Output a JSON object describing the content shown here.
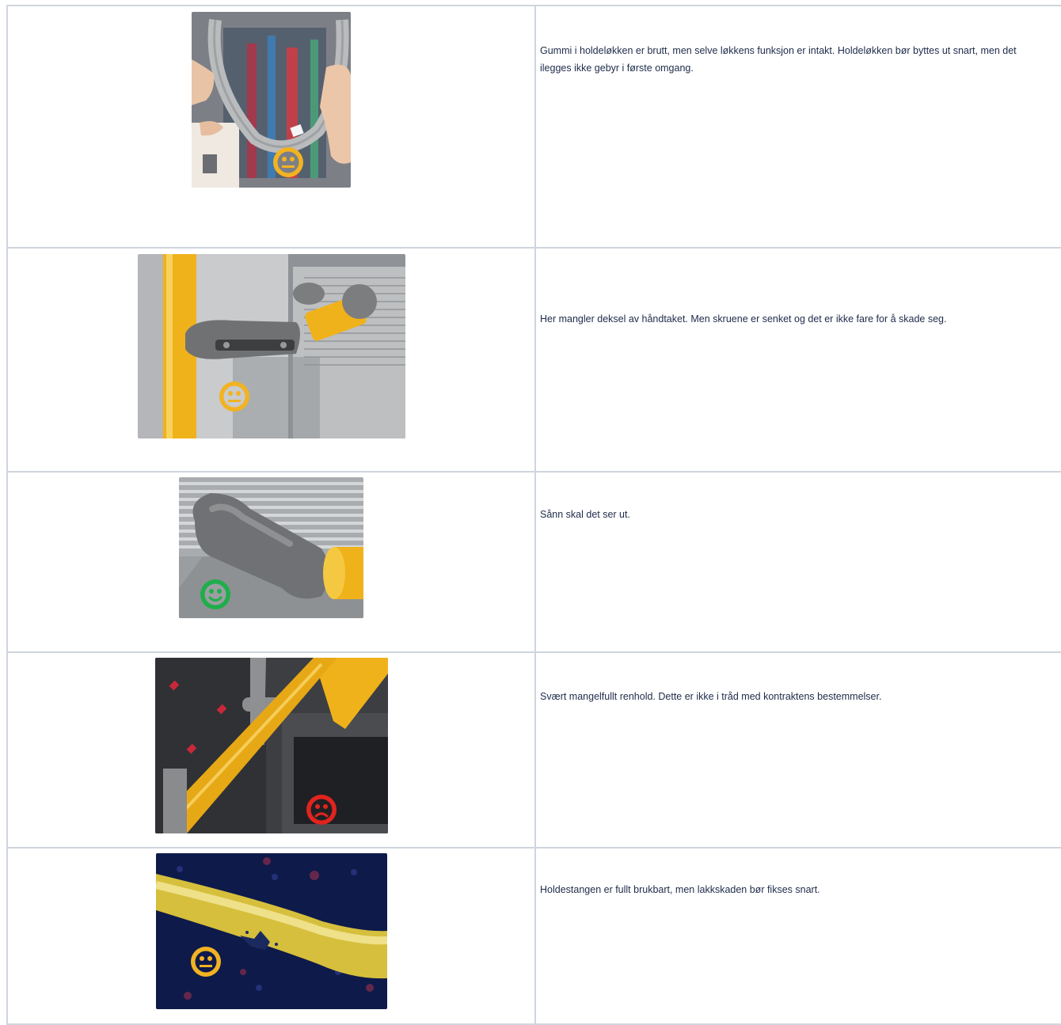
{
  "rows": [
    {
      "description": "Gummi i holdeløkken er brutt, men selve løkkens funksjon er intakt. Holdeløkken bør byttes ut snart, men det ilegges ikke gebyr i første omgang.",
      "rating": "neutral",
      "icon": "neutral-face-icon",
      "color": "#f2b322"
    },
    {
      "description": "Her mangler deksel av håndtaket. Men skruene er senket og det er ikke fare for å skade seg.",
      "rating": "neutral",
      "icon": "neutral-face-icon",
      "color": "#f2b322"
    },
    {
      "description": "Sånn skal det ser ut.",
      "rating": "happy",
      "icon": "happy-face-icon",
      "color": "#1fae4b"
    },
    {
      "description": "Svært mangelfullt renhold. Dette er ikke i tråd med kontraktens bestemmelser.",
      "rating": "sad",
      "icon": "sad-face-icon",
      "color": "#e0241f"
    },
    {
      "description": "Holdestangen er fullt brukbart, men lakkskaden bør fikses snart.",
      "rating": "neutral",
      "icon": "neutral-face-icon",
      "color": "#f2b322"
    }
  ]
}
